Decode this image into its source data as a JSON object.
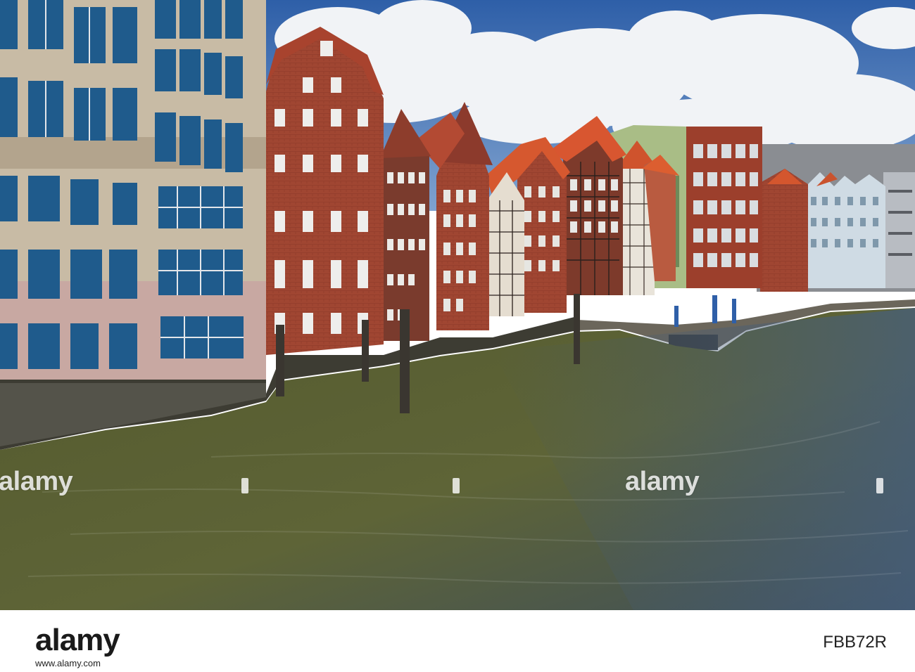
{
  "watermark": {
    "text": "alamy"
  },
  "footer": {
    "logo": "alamy",
    "image_id": "FBB72R",
    "url": "www.alamy.com"
  },
  "palette": {
    "sky": "#3d6fb0",
    "cloud": "#f2f4f7",
    "brick": "#a34a35",
    "roof": "#d4562e",
    "stone": "#c9bca6",
    "water": "#5d6033",
    "water_right": "#3e5368"
  }
}
